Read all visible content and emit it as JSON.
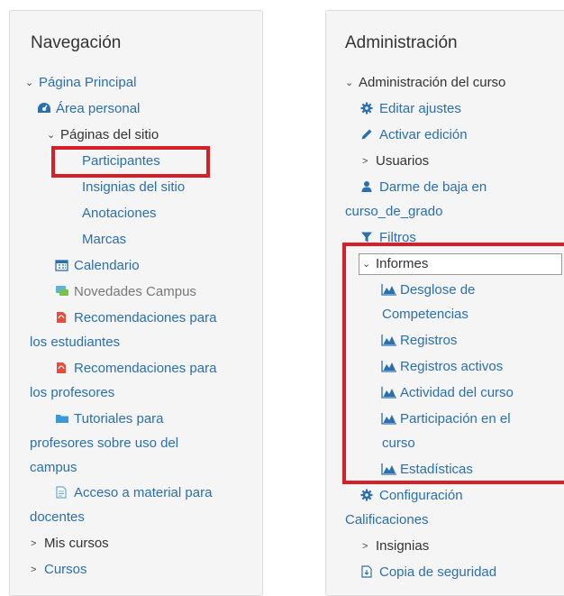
{
  "nav": {
    "title": "Navegación",
    "pagina_principal": "Página Principal",
    "area_personal": "Área personal",
    "paginas_sitio": "Páginas del sitio",
    "participantes": "Participantes",
    "insignias_sitio": "Insignias del sitio",
    "anotaciones": "Anotaciones",
    "marcas": "Marcas",
    "calendario": "Calendario",
    "novedades": "Novedades Campus",
    "reco_est_1": "Recomendaciones para",
    "reco_est_2": "los estudiantes",
    "reco_prof_1": "Recomendaciones para",
    "reco_prof_2": "los profesores",
    "tut_1": "Tutoriales para",
    "tut_2": "profesores sobre uso del",
    "tut_3": "campus",
    "acceso_1": "Acceso a material para",
    "acceso_2": "docentes",
    "mis_cursos": "Mis cursos",
    "cursos": "Cursos"
  },
  "admin": {
    "title": "Administración",
    "admin_curso": "Administración del curso",
    "editar_ajustes": "Editar ajustes",
    "activar_edicion": "Activar edición",
    "usuarios": "Usuarios",
    "darme_baja_1": "Darme de baja en",
    "darme_baja_2": "curso_de_grado",
    "filtros": "Filtros",
    "informes": "Informes",
    "desglose_1": "Desglose de",
    "desglose_2": "Competencias",
    "registros": "Registros",
    "registros_activos": "Registros activos",
    "actividad_curso": "Actividad del curso",
    "participacion_1": "Participación en el",
    "participacion_2": "curso",
    "estadisticas": "Estadísticas",
    "config_1": "Configuración",
    "config_2": "Calificaciones",
    "insignias": "Insignias",
    "copia_seguridad": "Copia de seguridad"
  },
  "colors": {
    "link": "#2a6fb0",
    "highlight": "#d52027"
  }
}
